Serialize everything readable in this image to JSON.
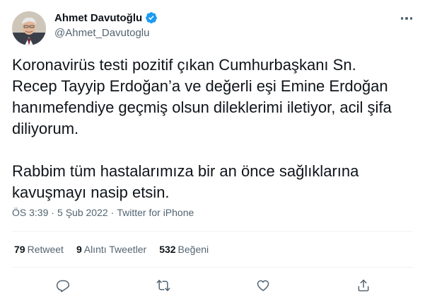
{
  "author": {
    "display_name": "Ahmet Davutoğlu",
    "handle": "@Ahmet_Davutoglu",
    "verified": true
  },
  "tweet": {
    "paragraph1_lines": [
      "Koronavirüs testi pozitif çıkan Cumhurbaşkanı Sn.",
      "Recep Tayyip Erdoğan’a ve değerli eşi Emine Erdoğan",
      "hanımefendiye geçmiş olsun dileklerimi iletiyor, acil şifa",
      "diliyorum."
    ],
    "paragraph2_lines": [
      "Rabbim tüm hastalarımıza bir an önce sağlıklarına",
      "kavuşmayı nasip etsin."
    ]
  },
  "meta": {
    "time": "ÖS 3:39",
    "separator": "·",
    "date": "5 Şub 2022",
    "source": "Twitter for iPhone"
  },
  "stats": {
    "retweets_count": "79",
    "retweets_label": "Retweet",
    "quotes_count": "9",
    "quotes_label": "Alıntı Tweetler",
    "likes_count": "532",
    "likes_label": "Beğeni"
  },
  "icons": {
    "verified": "verified-badge-icon",
    "more": "more-options-icon",
    "reply": "reply-icon",
    "retweet": "retweet-icon",
    "like": "like-icon",
    "share": "share-icon"
  },
  "colors": {
    "text": "#0f1419",
    "secondary": "#536471",
    "verified": "#1d9bf0",
    "divider": "#eff3f4"
  }
}
